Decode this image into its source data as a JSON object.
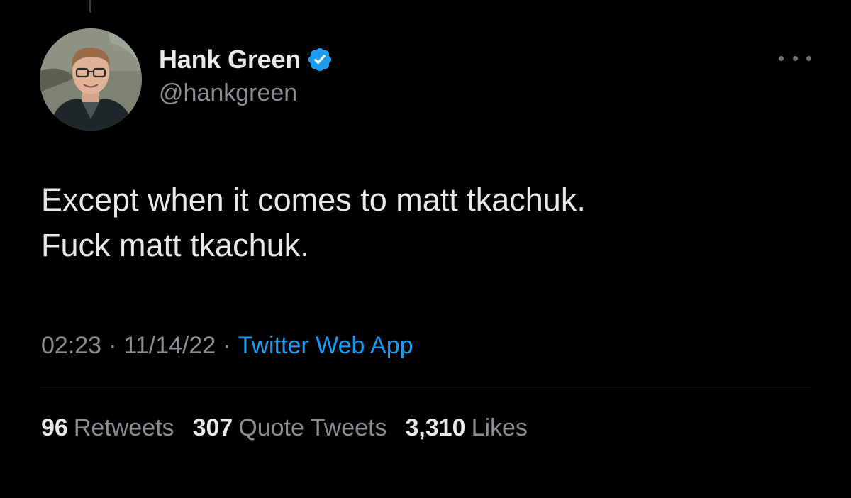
{
  "author": {
    "display_name": "Hank Green",
    "handle": "@hankgreen",
    "verified_icon": "verified-badge-icon",
    "avatar_icon": "profile-photo"
  },
  "tweet": {
    "lines": [
      "Except when it comes to matt tkachuk.",
      "Fuck matt tkachuk."
    ]
  },
  "meta": {
    "time": "02:23",
    "separator": "·",
    "date": "11/14/22",
    "source": "Twitter Web App"
  },
  "stats": [
    {
      "count": "96",
      "label": "Retweets"
    },
    {
      "count": "307",
      "label": "Quote Tweets"
    },
    {
      "count": "3,310",
      "label": "Likes"
    }
  ],
  "colors": {
    "background": "#000000",
    "text_primary": "#e7e9ea",
    "text_secondary": "#8b8f94",
    "accent": "#1d9bf0"
  },
  "icons": {
    "more": "more-options-icon"
  }
}
